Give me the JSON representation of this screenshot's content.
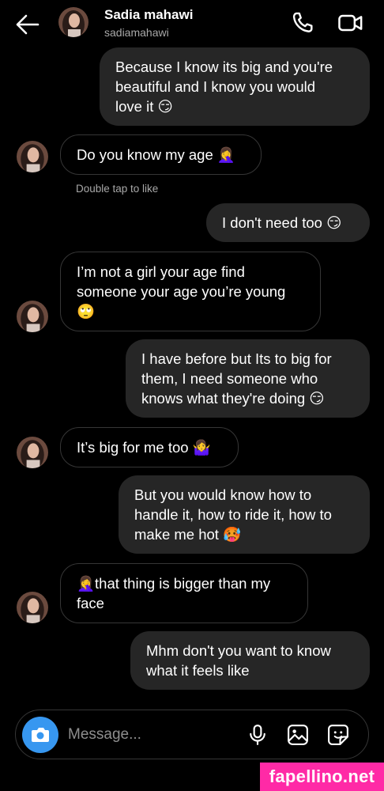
{
  "header": {
    "name": "Sadia mahawi",
    "username": "sadiamahawi",
    "icons": [
      "back-arrow-icon",
      "phone-icon",
      "video-camera-icon"
    ]
  },
  "messages": [
    {
      "side": "sent",
      "text": "Because I know its big and you're\nbeautiful and I know you would\nlove it 😏"
    },
    {
      "side": "received",
      "text": "Do you know my age 🤦‍♀️"
    },
    {
      "side": "sent",
      "text": "I don't need too 😏"
    },
    {
      "side": "received",
      "text": "I’m not a girl your age find\nsomeone your age you’re young\n🙄"
    },
    {
      "side": "sent",
      "text": "I have before but Its to big for\nthem, I need someone who\nknows what they're doing 😏"
    },
    {
      "side": "received",
      "text": "It’s big for me too 🤷‍♀️"
    },
    {
      "side": "sent",
      "text": "But you would know how to\nhandle it, how to ride it, how to\nmake me hot 🥵"
    },
    {
      "side": "received",
      "text": "🤦‍♀️that thing is bigger than my\nface"
    },
    {
      "side": "sent",
      "text": "Mhm don't you want to know\nwhat it feels like"
    }
  ],
  "double_tap_hint": "Double tap to like",
  "composer": {
    "placeholder": "Message...",
    "icons": [
      "camera-icon",
      "microphone-icon",
      "gallery-icon",
      "sticker-icon"
    ]
  },
  "watermark": "fapellino.net",
  "colors": {
    "background": "#000000",
    "sent_bubble": "#262626",
    "camera_button": "#3797f0",
    "watermark_bg": "#ff2aa6"
  }
}
